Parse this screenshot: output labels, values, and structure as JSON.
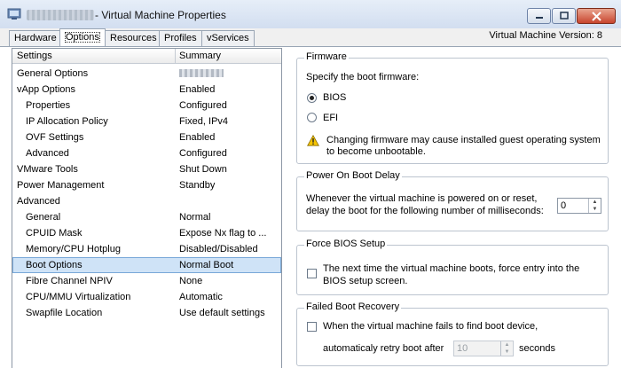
{
  "window": {
    "title": "- Virtual Machine Properties",
    "version": "Virtual Machine Version: 8"
  },
  "tabs": [
    {
      "label": "Hardware"
    },
    {
      "label": "Options"
    },
    {
      "label": "Resources"
    },
    {
      "label": "Profiles"
    },
    {
      "label": "vServices"
    }
  ],
  "settings_table": {
    "col_settings": "Settings",
    "col_summary": "Summary",
    "rows": [
      {
        "setting": "General Options",
        "summary": ""
      },
      {
        "setting": "vApp Options",
        "summary": "Enabled"
      },
      {
        "setting": "Properties",
        "summary": "Configured"
      },
      {
        "setting": "IP Allocation Policy",
        "summary": "Fixed, IPv4"
      },
      {
        "setting": "OVF Settings",
        "summary": "Enabled"
      },
      {
        "setting": "Advanced",
        "summary": "Configured"
      },
      {
        "setting": "VMware Tools",
        "summary": "Shut Down"
      },
      {
        "setting": "Power Management",
        "summary": "Standby"
      },
      {
        "setting": "Advanced",
        "summary": ""
      },
      {
        "setting": "General",
        "summary": "Normal"
      },
      {
        "setting": "CPUID Mask",
        "summary": "Expose Nx flag to ..."
      },
      {
        "setting": "Memory/CPU Hotplug",
        "summary": "Disabled/Disabled"
      },
      {
        "setting": "Boot Options",
        "summary": "Normal Boot"
      },
      {
        "setting": "Fibre Channel NPIV",
        "summary": "None"
      },
      {
        "setting": "CPU/MMU Virtualization",
        "summary": "Automatic"
      },
      {
        "setting": "Swapfile Location",
        "summary": "Use default settings"
      }
    ]
  },
  "firmware": {
    "title": "Firmware",
    "prompt": "Specify the boot firmware:",
    "bios_label": "BIOS",
    "efi_label": "EFI",
    "warning_line1": "Changing firmware may cause installed guest operating system",
    "warning_line2": "to become unbootable."
  },
  "power_on_delay": {
    "title": "Power On Boot Delay",
    "line1": "Whenever the virtual machine is powered on or reset,",
    "line2": "delay the boot for the following number of milliseconds:",
    "value": "0"
  },
  "force_bios": {
    "title": "Force BIOS Setup",
    "line1": "The next time the virtual machine boots, force entry into the",
    "line2": "BIOS setup screen."
  },
  "failed_boot": {
    "title": "Failed Boot Recovery",
    "line1": "When the virtual machine fails to find boot device,",
    "line2": "automaticaly retry boot after",
    "value": "10",
    "unit": "seconds"
  }
}
